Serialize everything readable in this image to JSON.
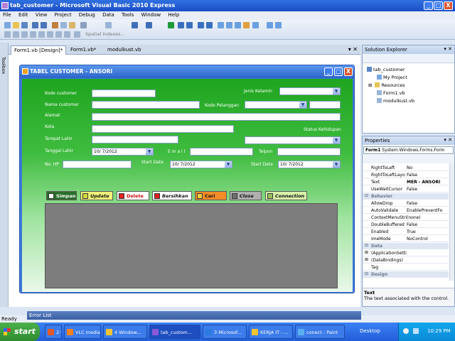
{
  "window": {
    "title": "tab_customer - Microsoft Visual Basic 2010 Express",
    "controls": {
      "minimize": "_",
      "maximize": "□",
      "close": "X"
    }
  },
  "menu": [
    "File",
    "Edit",
    "View",
    "Project",
    "Debug",
    "Data",
    "Tools",
    "Window",
    "Help"
  ],
  "toolbar": {
    "spatial_label": "Spatial Indexes..."
  },
  "toolbox_label": "Toolbox",
  "doc_tabs": [
    {
      "label": "Form1.vb [Design]*",
      "active": true
    },
    {
      "label": "Form1.vb*",
      "active": false
    },
    {
      "label": "modulkust.vb",
      "active": false
    }
  ],
  "form": {
    "title": "TABEL CUSTOMER - ANSORI",
    "labels": {
      "kode_customer": "Kode customer",
      "nama_customer": "Nama customer",
      "alamat": "Alamat",
      "kota": "Kota",
      "tempat_lahir": "Tempat Lahir",
      "tanggal_lahir": "Tanggal Lahir",
      "no_hp": "No. HP",
      "jenis_kelamin": "Jenis Kelamin",
      "kode_pelanggan": "Kode Pelanggan",
      "status_kehidupan": "Status Kehidupan",
      "email": "E m a i l",
      "telpon": "Telpon",
      "start_date_1": "Start Date",
      "start_date_2": "Start Date"
    },
    "dates": {
      "tanggal_lahir": "10/ 7/2012",
      "start_date_1": "10/ 7/2012",
      "start_date_2": "10/ 7/2012"
    },
    "buttons": {
      "simpan": "Simpan",
      "update": "Update",
      "delete": "Delete",
      "bersihkan": "Bersihkan",
      "cari": "Cari",
      "close": "Close",
      "connection": "Connection"
    },
    "button_colors": {
      "simpan": "#2a6f2a",
      "update": "#f2f27a",
      "delete": "#ffffff",
      "bersihkan": "#ffffff",
      "cari": "#f28c28",
      "close": "#b0b0b0",
      "connection": "#d8f0a8"
    }
  },
  "solution_explorer": {
    "header": "Solution Explorer",
    "pin": "▾ ✕",
    "items": [
      {
        "label": "tab_customer",
        "level": 0
      },
      {
        "label": "My Project",
        "level": 1
      },
      {
        "label": "Resources",
        "level": 1
      },
      {
        "label": "Form1.vb",
        "level": 1
      },
      {
        "label": "modulkust.vb",
        "level": 1
      }
    ]
  },
  "properties": {
    "header": "Properties",
    "pin": "▾ ✕",
    "object": "Form1",
    "object_type": "System.Windows.Forms.Form",
    "rows": [
      {
        "name": "RightToLeft",
        "value": "No",
        "type": "prop"
      },
      {
        "name": "RightToLeftLayo",
        "value": "False",
        "type": "prop"
      },
      {
        "name": "Text",
        "value": "MER - ANSORI",
        "type": "selected"
      },
      {
        "name": "UseWaitCursor",
        "value": "False",
        "type": "prop"
      },
      {
        "name": "Behavior",
        "value": "",
        "type": "cat"
      },
      {
        "name": "AllowDrop",
        "value": "False",
        "type": "prop"
      },
      {
        "name": "AutoValidate",
        "value": "EnablePreventFo",
        "type": "prop"
      },
      {
        "name": "ContextMenuStri",
        "value": "(none)",
        "type": "prop"
      },
      {
        "name": "DoubleBuffered",
        "value": "False",
        "type": "prop"
      },
      {
        "name": "Enabled",
        "value": "True",
        "type": "prop"
      },
      {
        "name": "ImeMode",
        "value": "NoControl",
        "type": "prop"
      },
      {
        "name": "Data",
        "value": "",
        "type": "cat"
      },
      {
        "name": "(ApplicationSetti",
        "value": "",
        "type": "expand"
      },
      {
        "name": "(DataBindings)",
        "value": "",
        "type": "expand"
      },
      {
        "name": "Tag",
        "value": "",
        "type": "prop"
      },
      {
        "name": "Design",
        "value": "",
        "type": "cat"
      }
    ],
    "desc_title": "Text",
    "desc_text": "The text associated with the control."
  },
  "error_list": {
    "label": "Error List"
  },
  "status": {
    "text": "Ready"
  },
  "taskbar": {
    "start_label": "start",
    "tasks": [
      {
        "label": "2 G...",
        "color": "#e05a2a"
      },
      {
        "label": "VLC media ...",
        "color": "#f08020"
      },
      {
        "label": "4 Window...",
        "color": "#f4c430"
      },
      {
        "label": "tab_custom...",
        "color": "#8a5ad6"
      },
      {
        "label": "3 Microsof...",
        "color": "#2a7ae0"
      },
      {
        "label": "KERJA IT - ...",
        "color": "#f4c430"
      },
      {
        "label": "conect - Paint",
        "color": "#5ab0f0"
      }
    ],
    "desktop_label": "Desktop",
    "clock": "10:29 PM"
  }
}
